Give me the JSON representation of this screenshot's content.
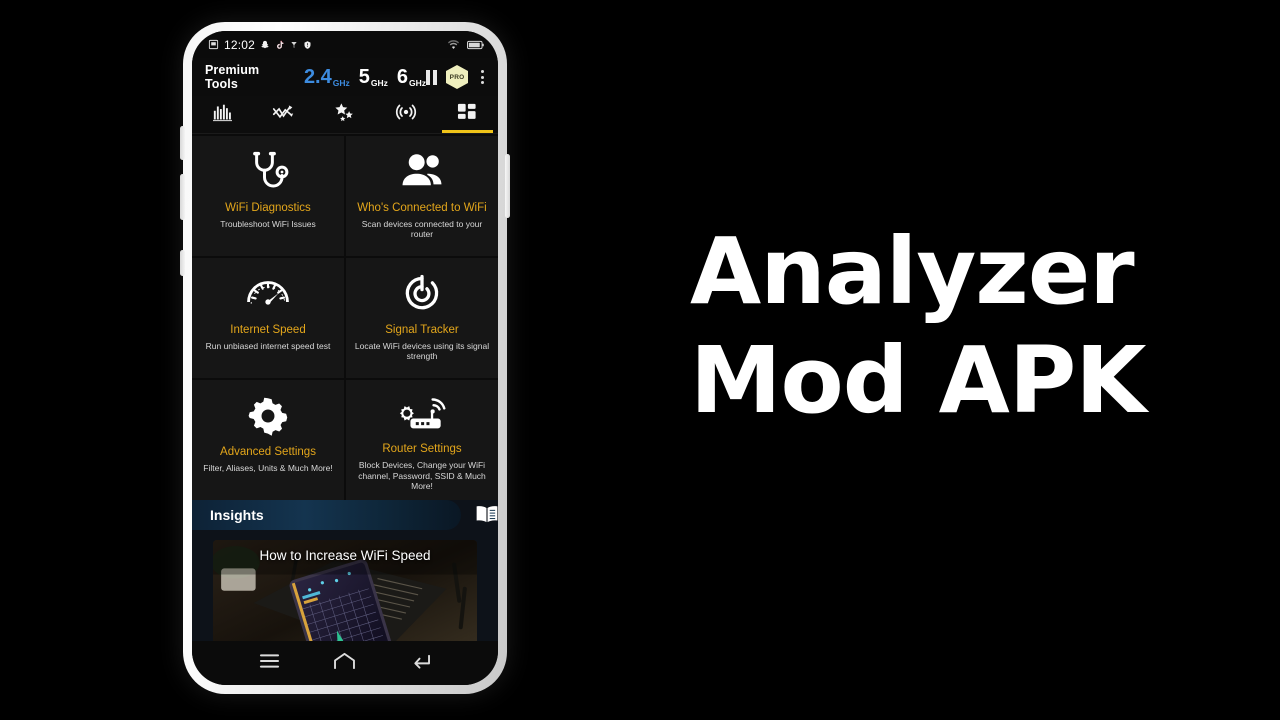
{
  "headline": {
    "line1": "Analyzer",
    "line2": "Mod APK"
  },
  "phone": {
    "status_bar": {
      "clock": "12:02",
      "icons_left": [
        "screenshot-icon",
        "snapchat-icon",
        "tiktok-icon",
        "vpn-key-icon",
        "shield-icon"
      ],
      "icons_right": [
        "wifi-icon",
        "battery-icon"
      ]
    },
    "app_bar": {
      "title": "Premium Tools",
      "bands": [
        {
          "num": "2.4",
          "unit": "GHz",
          "active": true
        },
        {
          "num": "5",
          "unit": "GHz",
          "active": false
        },
        {
          "num": "6",
          "unit": "GHz",
          "active": false
        }
      ],
      "pause_label": "pause-scan",
      "pro_badge": "PRO",
      "overflow_label": "More options"
    },
    "tabs": [
      {
        "name": "channel-graph",
        "icon": "bar-chart-icon",
        "active": false
      },
      {
        "name": "time-graph",
        "icon": "line-chart-icon",
        "active": false
      },
      {
        "name": "channel-rating",
        "icon": "stars-icon",
        "active": false
      },
      {
        "name": "signal-meter",
        "icon": "radar-icon",
        "active": false
      },
      {
        "name": "premium-tools",
        "icon": "grid-icon",
        "active": true
      }
    ],
    "tools": [
      {
        "icon": "stethoscope-icon",
        "title": "WiFi Diagnostics",
        "desc": "Troubleshoot WiFi Issues"
      },
      {
        "icon": "people-icon",
        "title": "Who's Connected to WiFi",
        "desc": "Scan devices connected to your router"
      },
      {
        "icon": "speedometer-icon",
        "title": "Internet Speed",
        "desc": "Run unbiased internet speed test"
      },
      {
        "icon": "signal-target-icon",
        "title": "Signal Tracker",
        "desc": "Locate WiFi devices using its signal strength"
      },
      {
        "icon": "gear-icon",
        "title": "Advanced Settings",
        "desc": "Filter, Aliases, Units & Much More!"
      },
      {
        "icon": "router-icon",
        "title": "Router Settings",
        "desc": "Block Devices, Change your WiFi channel, Password, SSID & Much More!"
      }
    ],
    "insights": {
      "title": "Insights",
      "book_icon": "open-book-icon",
      "video_title": "How to Increase WiFi Speed"
    },
    "nav_bar": {
      "recents": "recents-icon",
      "home": "home-icon",
      "back": "back-icon"
    }
  },
  "colors": {
    "accent_gold": "#e3a61b",
    "tab_underline": "#f0c419",
    "band_active": "#3d8ce0",
    "pro_badge_bg": "#efefbe",
    "tile_bg": "#161616",
    "screen_bg": "#0b0b0b"
  }
}
